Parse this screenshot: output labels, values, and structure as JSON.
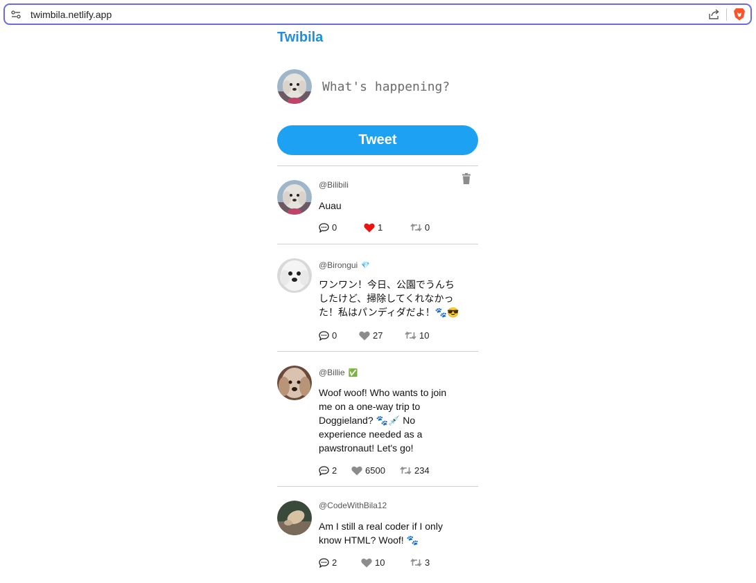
{
  "browser": {
    "url": "twimbila.netlify.app",
    "icons": {
      "site_info": "tune-icon",
      "share": "share-icon",
      "brave": "brave-lion-icon"
    },
    "colors": {
      "focus_border": "#6a6ae0",
      "brave": "#fb542b"
    }
  },
  "app": {
    "brand": "Twibila",
    "compose": {
      "placeholder": "What's happening?"
    },
    "tweet_button": "Tweet",
    "colors": {
      "brand": "#1d8ee0",
      "button": "#1da1f2",
      "like_active": "#ee1111",
      "icon_muted": "#8c8c8c"
    }
  },
  "posts": [
    {
      "handle": "@Bilibili",
      "badge": "",
      "body": "Auau",
      "replies": "0",
      "likes": "1",
      "retweets": "0",
      "liked": true,
      "deletable": true,
      "avatar": "white-poodle-avatar"
    },
    {
      "handle": "@Birongui",
      "badge": "💎",
      "body": "ワンワン！今日、公園でうんちしたけど、掃除してくれなかった！私はパンディダだよ！🐾😎",
      "replies": "0",
      "likes": "27",
      "retweets": "10",
      "liked": false,
      "deletable": false,
      "avatar": "white-dog-face-avatar"
    },
    {
      "handle": "@Billie",
      "badge": "✅",
      "body": "Woof woof! Who wants to join me on a one-way trip to Doggieland? 🐾💉 No experience needed as a pawstronaut! Let's go!",
      "replies": "2",
      "likes": "6500",
      "retweets": "234",
      "liked": false,
      "deletable": false,
      "avatar": "brown-dog-avatar"
    },
    {
      "handle": "@CodeWithBila12",
      "badge": "",
      "body": "Am I still a real coder if I only know HTML? Woof! 🐾",
      "replies": "2",
      "likes": "10",
      "retweets": "3",
      "liked": false,
      "deletable": false,
      "avatar": "dog-on-couch-avatar"
    }
  ]
}
